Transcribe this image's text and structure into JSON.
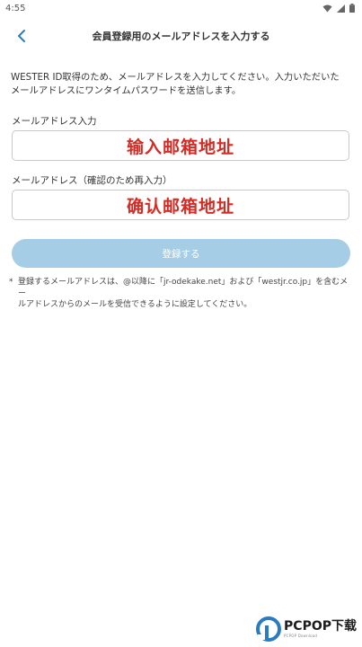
{
  "status_bar": {
    "time": "4:55"
  },
  "header": {
    "title": "会員登録用のメールアドレスを入力する"
  },
  "intro": {
    "text": "WESTER ID取得のため、メールアドレスを入力してください。入力いただいた\nメールアドレスにワンタイムパスワードを送信します。"
  },
  "fields": [
    {
      "label": "メールアドレス入力",
      "value": "输入邮箱地址"
    },
    {
      "label": "メールアドレス（確認のため再入力）",
      "value": "确认邮箱地址"
    }
  ],
  "submit": {
    "label": "登録する"
  },
  "note": {
    "bullet": "*",
    "text": "登録するメールアドレスは、@以降に「jr-odekake.net」および「westjr.co.jp」を含むメー\nルアドレスからのメールを受信できるように設定してください。"
  },
  "watermark": {
    "text": "PCPOP下载",
    "sub": "PCPOP Download"
  },
  "colors": {
    "accent": "#2b7bc0",
    "input_text": "#d42c24",
    "button_disabled": "#a6cde6"
  }
}
